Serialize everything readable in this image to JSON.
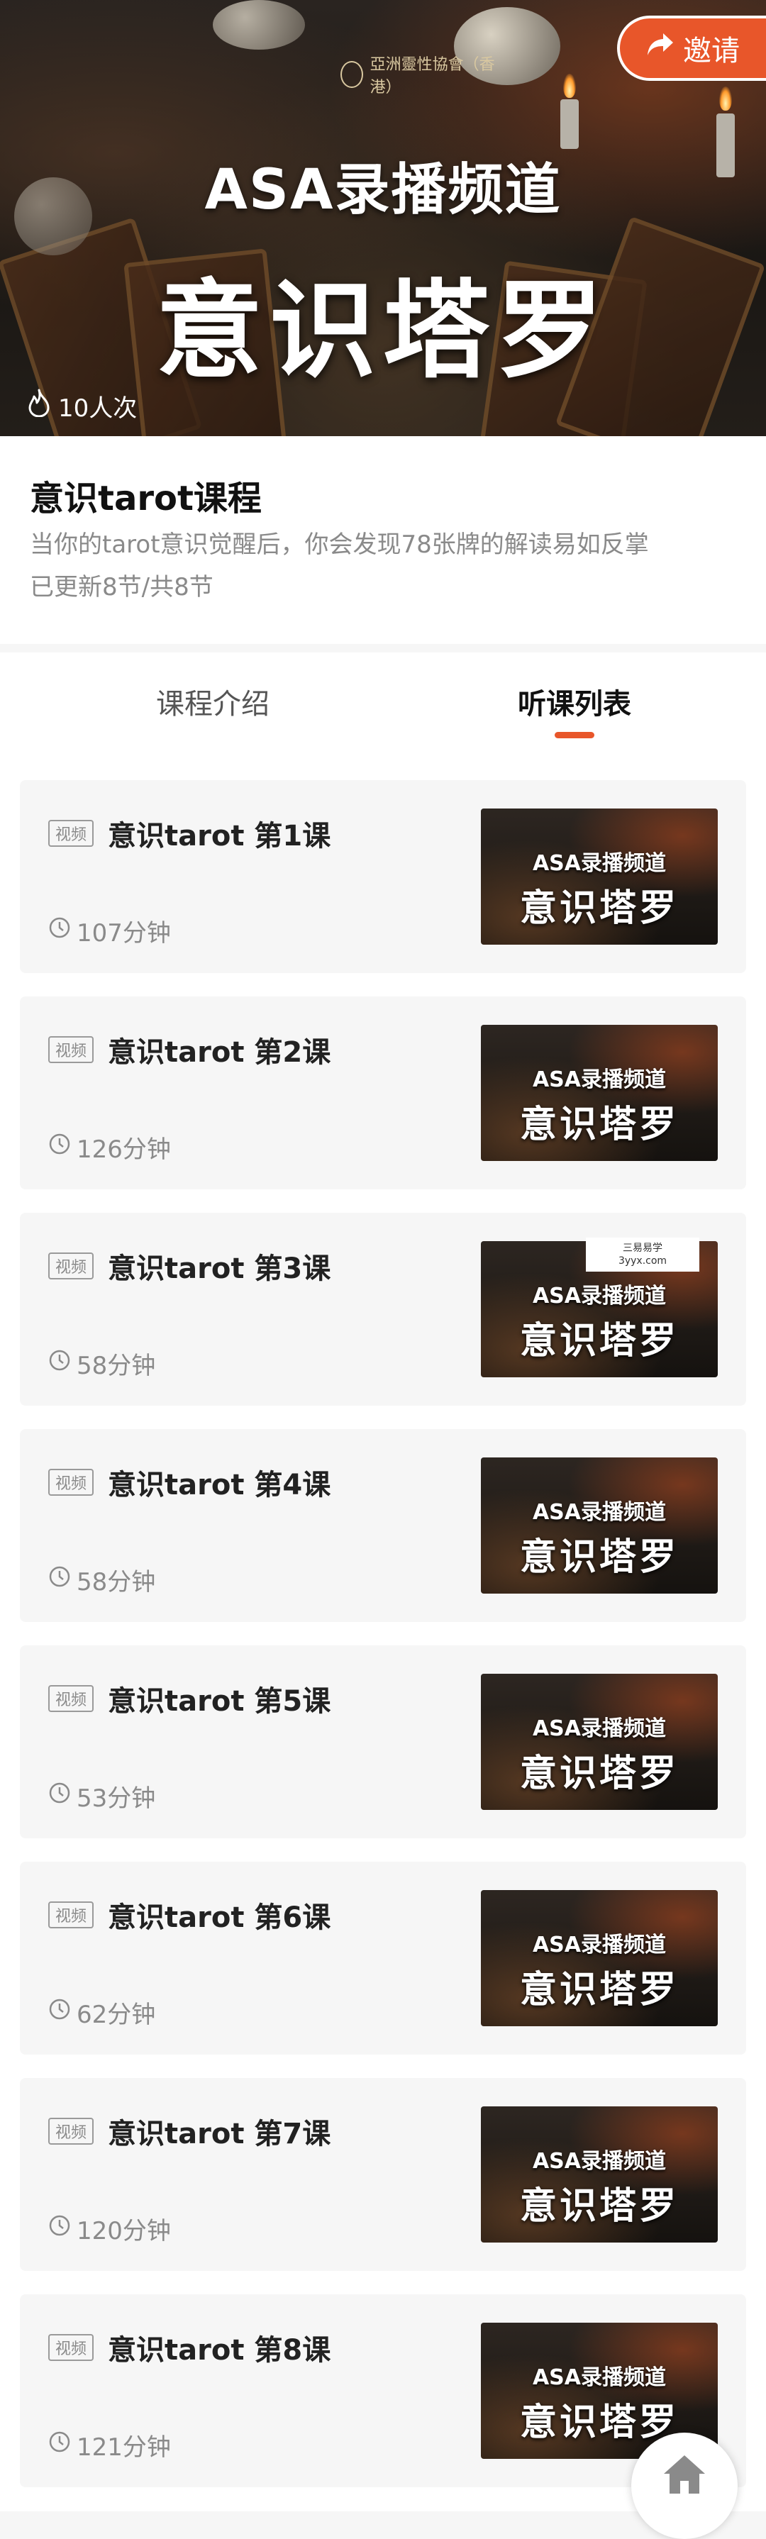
{
  "banner": {
    "seal_text": "亞洲靈性協會（香港）",
    "title_line1": "ASA录播频道",
    "title_line2": "意识塔罗",
    "views": "10人次",
    "invite_label": "邀请"
  },
  "course": {
    "title": "意识tarot课程",
    "description": "当你的tarot意识觉醒后，你会发现78张牌的解读易如反掌",
    "progress": "已更新8节/共8节"
  },
  "tabs": [
    {
      "label": "课程介绍",
      "active": false
    },
    {
      "label": "听课列表",
      "active": true
    }
  ],
  "lesson_tag": "视频",
  "thumb_line1": "ASA录播频道",
  "thumb_line2": "意识塔罗",
  "lessons": [
    {
      "title": "意识tarot 第1课",
      "duration": "107分钟"
    },
    {
      "title": "意识tarot 第2课",
      "duration": "126分钟"
    },
    {
      "title": "意识tarot 第3课",
      "duration": "58分钟"
    },
    {
      "title": "意识tarot 第4课",
      "duration": "58分钟"
    },
    {
      "title": "意识tarot 第5课",
      "duration": "53分钟"
    },
    {
      "title": "意识tarot 第6课",
      "duration": "62分钟"
    },
    {
      "title": "意识tarot 第7课",
      "duration": "120分钟"
    },
    {
      "title": "意识tarot 第8课",
      "duration": "121分钟"
    }
  ],
  "watermark": {
    "line1": "三易易学",
    "line2": "3yyx.com"
  },
  "colors": {
    "accent": "#e8562a",
    "muted_text": "#8a8a8a"
  },
  "icons": {
    "views": "flame-icon",
    "invite": "share-arrow-icon",
    "duration": "clock-icon",
    "home": "home-icon"
  }
}
